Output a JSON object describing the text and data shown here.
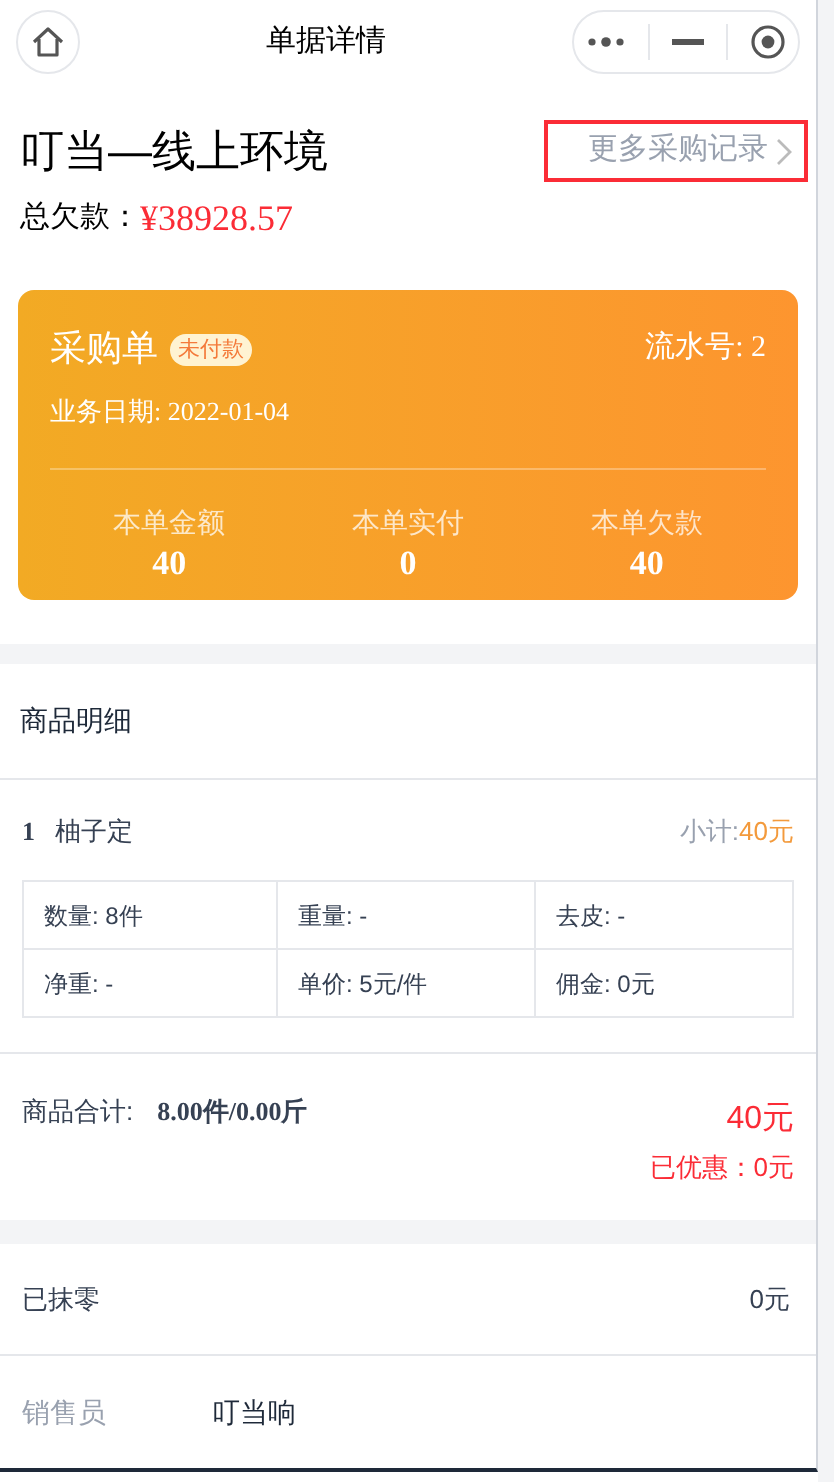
{
  "nav_bar": {
    "title": "单据详情"
  },
  "header": {
    "store_name": "叮当—线上环境",
    "more_link": "更多采购记录",
    "more_link_highlighted": true,
    "total_debt_label": "总欠款：",
    "total_debt_value": "¥38928.57"
  },
  "order_card": {
    "title": "采购单",
    "status_badge": "未付款",
    "serial": "流水号: 2",
    "date": "业务日期: 2022-01-04",
    "stats": [
      {
        "label": "本单金额",
        "value": "40"
      },
      {
        "label": "本单实付",
        "value": "0"
      },
      {
        "label": "本单欠款",
        "value": "40"
      }
    ]
  },
  "goods_section": {
    "heading": "商品明细",
    "items": [
      {
        "index": "1",
        "name": "柚子定",
        "subtotal_label": "小计: ",
        "subtotal_value": "40元",
        "details": [
          "数量: 8件",
          "重量: -",
          "去皮: -",
          "净重: -",
          "单价: 5元/件",
          "佣金: 0元"
        ]
      }
    ],
    "total_label": "商品合计:",
    "total_value": "8.00件/0.00斤",
    "total_amount": "40元",
    "discount": "已优惠：0元"
  },
  "rows": [
    {
      "label": "已抹零",
      "value": "0元",
      "kind": "amount"
    },
    {
      "label": "销售员",
      "value": "叮当响",
      "kind": "person"
    }
  ]
}
